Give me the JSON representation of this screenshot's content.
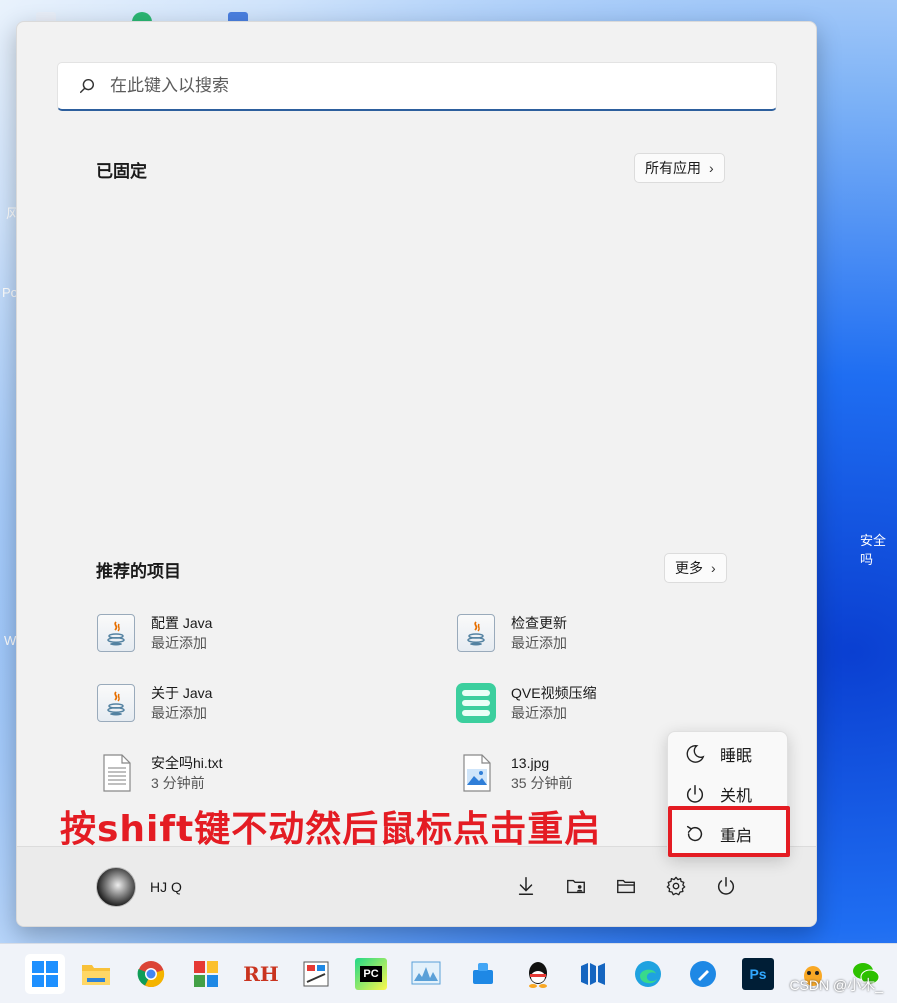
{
  "desktop": {
    "labels": [
      "风",
      "Po",
      "W",
      "安全吗"
    ],
    "watermark": "CSDN @小木_"
  },
  "search": {
    "placeholder": "在此键入以搜索"
  },
  "pinned": {
    "title": "已固定",
    "all_apps_label": "所有应用"
  },
  "recommended": {
    "title": "推荐的项目",
    "more_label": "更多",
    "items": [
      {
        "name": "配置 Java",
        "sub": "最近添加",
        "icon": "java-icon"
      },
      {
        "name": "检查更新",
        "sub": "最近添加",
        "icon": "java-icon"
      },
      {
        "name": "关于 Java",
        "sub": "最近添加",
        "icon": "java-icon"
      },
      {
        "name": "QVE视频压缩",
        "sub": "最近添加",
        "icon": "qve-app-icon"
      },
      {
        "name": "安全吗hi.txt",
        "sub": "3 分钟前",
        "icon": "text-file-icon"
      },
      {
        "name": "13.jpg",
        "sub": "35 分钟前",
        "icon": "image-file-icon"
      }
    ]
  },
  "user": {
    "name": "HJ Q"
  },
  "power_menu": {
    "sleep_label": "睡眠",
    "shutdown_label": "关机",
    "restart_label": "重启"
  },
  "annotation": {
    "text": "按shift键不动然后鼠标点击重启",
    "color": "#e41c23"
  },
  "taskbar": {
    "icons": [
      "windows-start-icon",
      "file-explorer-icon",
      "chrome-icon",
      "app-icon",
      "rh-icon",
      "app-icon",
      "pycharm-icon",
      "monitor-icon",
      "app-icon",
      "qq-icon",
      "app-icon",
      "edge-icon",
      "app-icon",
      "photoshop-icon",
      "app-icon",
      "wechat-icon"
    ],
    "rh_label": "RH",
    "pc_label": "PC",
    "ps_label": "Ps"
  }
}
